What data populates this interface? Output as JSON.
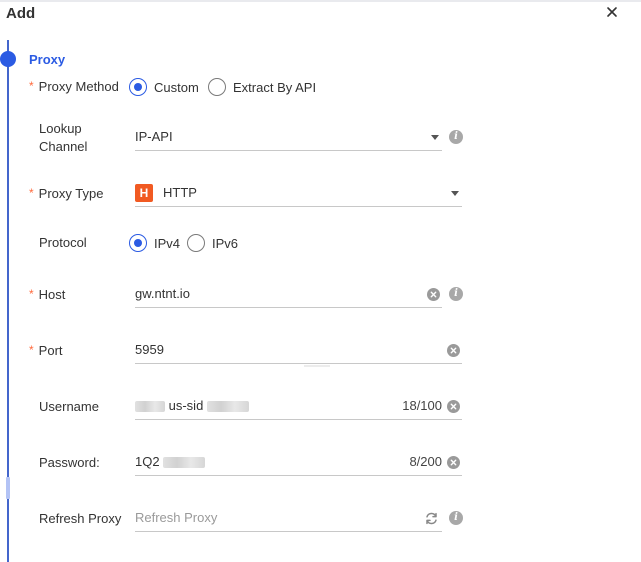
{
  "dialog": {
    "title": "Add"
  },
  "section": {
    "title": "Proxy"
  },
  "proxy_method": {
    "label": "Proxy Method",
    "options": [
      {
        "label": "Custom",
        "checked": true
      },
      {
        "label": "Extract By API",
        "checked": false
      }
    ]
  },
  "lookup_channel": {
    "label": "Lookup Channel",
    "value": "IP-API"
  },
  "proxy_type": {
    "label": "Proxy Type",
    "badge": "H",
    "value": "HTTP",
    "badge_color": "#f15a22"
  },
  "protocol": {
    "label": "Protocol",
    "options": [
      {
        "label": "IPv4",
        "checked": true
      },
      {
        "label": "IPv6",
        "checked": false
      }
    ]
  },
  "host": {
    "label": "Host",
    "value": "gw.ntnt.io"
  },
  "port": {
    "label": "Port",
    "value": "5959"
  },
  "username": {
    "label": "Username",
    "value_visible": "us-sid",
    "counter": "18/100"
  },
  "password": {
    "label": "Password:",
    "value_visible": "1Q2",
    "counter": "8/200"
  },
  "refresh_proxy": {
    "label": "Refresh Proxy",
    "placeholder": "Refresh Proxy"
  },
  "colors": {
    "accent": "#2b5be3",
    "required": "#ff6a3d",
    "timeline": "#4466cc"
  },
  "icons": {
    "close": "close-icon",
    "info": "info-icon",
    "clear": "clear-icon",
    "caret": "caret-down-icon",
    "refresh": "refresh-icon"
  }
}
